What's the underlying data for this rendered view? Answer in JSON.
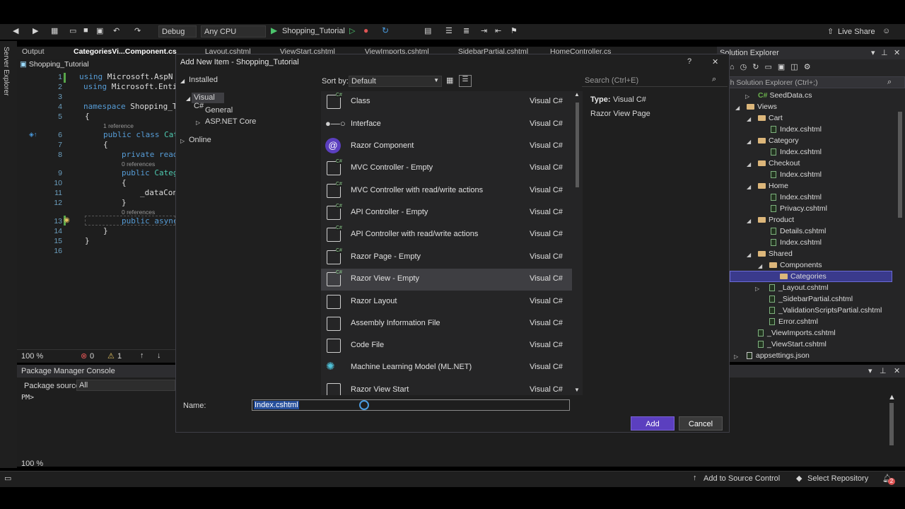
{
  "toolbar": {
    "config": "Debug",
    "platform": "Any CPU",
    "run_target": "Shopping_Tutorial",
    "live_share": "Live Share"
  },
  "left_strip": {
    "label": "Server Explorer"
  },
  "editor_tabs": [
    "Output",
    "CategoriesVi...Component.cs",
    "_Layout.cshtml",
    "_ViewStart.cshtml",
    "_ViewImports.cshtml",
    "_SidebarPartial.cshtml",
    "HomeController.cs"
  ],
  "editor": {
    "project_selector": "Shopping_Tutorial",
    "line_numbers": [
      "1",
      "2",
      "3",
      "4",
      "5",
      "6",
      "7",
      "8",
      "9",
      "10",
      "11",
      "12",
      "13",
      "14",
      "15",
      "16"
    ],
    "lines": {
      "l1a": "using",
      "l1b": " Microsoft.AspN",
      "l2a": "using",
      "l2b": " Microsoft.Enti",
      "l4a": "namespace",
      "l4b": " Shopping_T",
      "l5": "{",
      "l6a": "public",
      "l6b": " class",
      "l6c": " Cat",
      "l7": "{",
      "l8a": "private",
      "l8b": " read",
      "l9a": "public",
      "l9b": " Categ",
      "l10": "{",
      "l11": "_dataCon",
      "l12": "}",
      "l13a": "public",
      "l13b": " async",
      "l14": "}",
      "l15": "}"
    },
    "codelens_1": "1 reference",
    "codelens_2": "0 references",
    "codelens_3": "0 references",
    "zoom": "100 %",
    "errors": "0",
    "warnings": "1"
  },
  "package_console": {
    "title": "Package Manager Console",
    "source_label": "Package source:",
    "source_value": "All",
    "prompt": "PM>",
    "zoom": "100 %"
  },
  "statusbar": {
    "add_source_control": "Add to Source Control",
    "select_repository": "Select Repository",
    "notif_count": "2"
  },
  "solution_explorer": {
    "title": "Solution Explorer",
    "search_placeholder": "arch Solution Explorer (Ctrl+;)",
    "items": [
      {
        "label": "SeedData.cs",
        "kind": "cs"
      },
      {
        "label": "Views",
        "kind": "folder"
      },
      {
        "label": "Cart",
        "kind": "folder"
      },
      {
        "label": "Index.cshtml",
        "kind": "file"
      },
      {
        "label": "Category",
        "kind": "folder"
      },
      {
        "label": "Index.cshtml",
        "kind": "file"
      },
      {
        "label": "Checkout",
        "kind": "folder"
      },
      {
        "label": "Index.cshtml",
        "kind": "file"
      },
      {
        "label": "Home",
        "kind": "folder"
      },
      {
        "label": "Index.cshtml",
        "kind": "file"
      },
      {
        "label": "Privacy.cshtml",
        "kind": "file"
      },
      {
        "label": "Product",
        "kind": "folder"
      },
      {
        "label": "Details.cshtml",
        "kind": "file"
      },
      {
        "label": "Index.cshtml",
        "kind": "file"
      },
      {
        "label": "Shared",
        "kind": "folder"
      },
      {
        "label": "Components",
        "kind": "folder"
      },
      {
        "label": "Categories",
        "kind": "folder",
        "selected": true
      },
      {
        "label": "_Layout.cshtml",
        "kind": "file"
      },
      {
        "label": "_SidebarPartial.cshtml",
        "kind": "file"
      },
      {
        "label": "_ValidationScriptsPartial.cshtml",
        "kind": "file"
      },
      {
        "label": "Error.cshtml",
        "kind": "file"
      },
      {
        "label": "_ViewImports.cshtml",
        "kind": "file"
      },
      {
        "label": "_ViewStart.cshtml",
        "kind": "file"
      },
      {
        "label": "appsettings.json",
        "kind": "file"
      }
    ]
  },
  "dialog": {
    "title": "Add New Item - Shopping_Tutorial",
    "help": "?",
    "close": "✕",
    "tree": {
      "installed": "Installed",
      "visual_csharp": "Visual C#",
      "general": "General",
      "aspnet_core": "ASP.NET Core",
      "online": "Online"
    },
    "sort_label": "Sort by:",
    "sort_value": "Default",
    "search_placeholder": "Search (Ctrl+E)",
    "templates": [
      {
        "name": "Class",
        "lang": "Visual C#"
      },
      {
        "name": "Interface",
        "lang": "Visual C#"
      },
      {
        "name": "Razor Component",
        "lang": "Visual C#"
      },
      {
        "name": "MVC Controller - Empty",
        "lang": "Visual C#"
      },
      {
        "name": "MVC Controller with read/write actions",
        "lang": "Visual C#"
      },
      {
        "name": "API Controller - Empty",
        "lang": "Visual C#"
      },
      {
        "name": "API Controller with read/write actions",
        "lang": "Visual C#"
      },
      {
        "name": "Razor Page - Empty",
        "lang": "Visual C#"
      },
      {
        "name": "Razor View - Empty",
        "lang": "Visual C#",
        "selected": true
      },
      {
        "name": "Razor Layout",
        "lang": "Visual C#"
      },
      {
        "name": "Assembly Information File",
        "lang": "Visual C#"
      },
      {
        "name": "Code File",
        "lang": "Visual C#"
      },
      {
        "name": "Machine Learning Model (ML.NET)",
        "lang": "Visual C#"
      },
      {
        "name": "Razor View Start",
        "lang": "Visual C#"
      }
    ],
    "details": {
      "type_label": "Type:",
      "type_value": "Visual C#",
      "description": "Razor View Page"
    },
    "name_label": "Name:",
    "name_value": "Index.cshtml",
    "add_label": "Add",
    "cancel_label": "Cancel"
  },
  "colors": {
    "accent": "#6b4fbb",
    "selection": "#3e3e42",
    "tree_select": "#3a3a8c"
  }
}
